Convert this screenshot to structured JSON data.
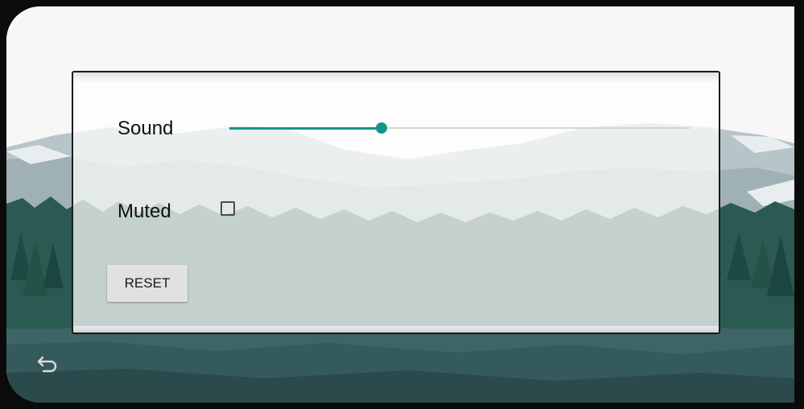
{
  "colors": {
    "accent": "#12968a",
    "track": "#d4d6d6",
    "button_bg": "#e1e1e1",
    "mountain_far": "#b7c5c8",
    "forest_near": "#1f4a44",
    "ground": "#3f6466"
  },
  "settings": {
    "sound": {
      "label": "Sound",
      "value": 0.33
    },
    "muted": {
      "label": "Muted",
      "checked": false
    },
    "reset_label": "RESET"
  },
  "navigation": {
    "back_icon": "back-arrow-icon"
  }
}
